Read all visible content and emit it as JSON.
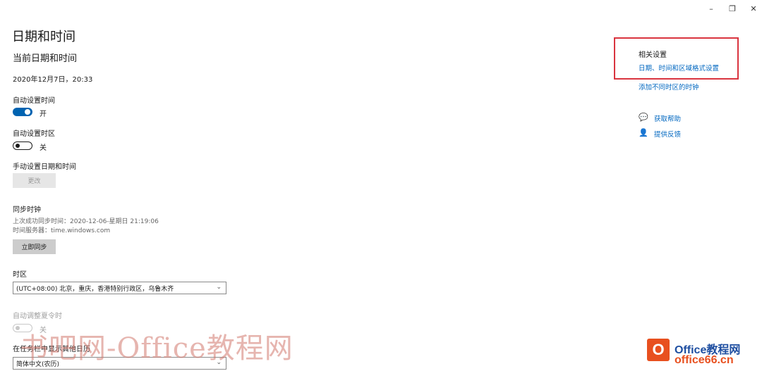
{
  "window": {
    "minimize": "–",
    "restore": "❐",
    "close": "✕"
  },
  "page_title": "日期和时间",
  "section_title": "当前日期和时间",
  "current_datetime": "2020年12月7日，20:33",
  "auto_time": {
    "label": "自动设置时间",
    "state": "开"
  },
  "auto_timezone": {
    "label": "自动设置时区",
    "state": "关"
  },
  "manual": {
    "label": "手动设置日期和时间",
    "button": "更改"
  },
  "sync": {
    "label": "同步时钟",
    "last_sync": "上次成功同步时间：2020-12-06-星期日 21:19:06",
    "server": "时间服务器：time.windows.com",
    "button": "立即同步"
  },
  "timezone": {
    "label": "时区",
    "value": "(UTC+08:00) 北京，重庆，香港特别行政区，乌鲁木齐"
  },
  "dst": {
    "label": "自动调整夏令时",
    "state": "关"
  },
  "calendar": {
    "label": "在任务栏中显示其他日历",
    "value": "简体中文(农历)"
  },
  "related": {
    "title": "相关设置",
    "links": [
      "日期、时间和区域格式设置",
      "添加不同时区的时钟"
    ]
  },
  "help": {
    "get_help": "获取帮助",
    "feedback": "提供反馈"
  },
  "watermark": {
    "text": "书吧网-Office教程网",
    "logo_line1": "Office教程网",
    "logo_line2": "office66.cn"
  }
}
